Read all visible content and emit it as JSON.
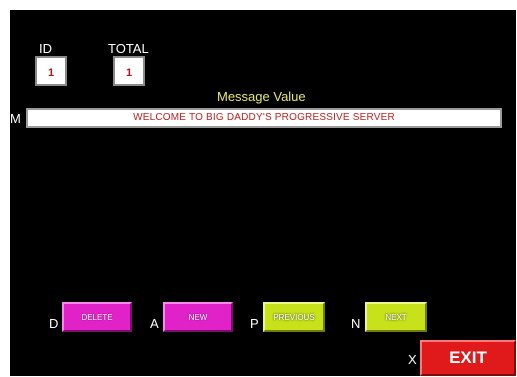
{
  "fields": {
    "id_label": "ID",
    "id_value": "1",
    "total_label": "TOTAL",
    "total_value": "1"
  },
  "message": {
    "title": "Message Value",
    "key": "M",
    "value": "WELCOME TO BIG DADDY'S PROGRESSIVE SERVER"
  },
  "actions": {
    "delete": {
      "key": "D",
      "label": "DELETE"
    },
    "new": {
      "key": "A",
      "label": "NEW"
    },
    "previous": {
      "key": "P",
      "label": "PREVIOUS"
    },
    "next": {
      "key": "N",
      "label": "NEXT"
    },
    "exit": {
      "key": "X",
      "label": "EXIT"
    }
  },
  "colors": {
    "background": "#000000",
    "magenta_button": "#e022c8",
    "lime_button": "#c7e21a",
    "exit_button": "#e01a1a",
    "message_title": "#e8e870",
    "field_text": "#c21e1e"
  }
}
